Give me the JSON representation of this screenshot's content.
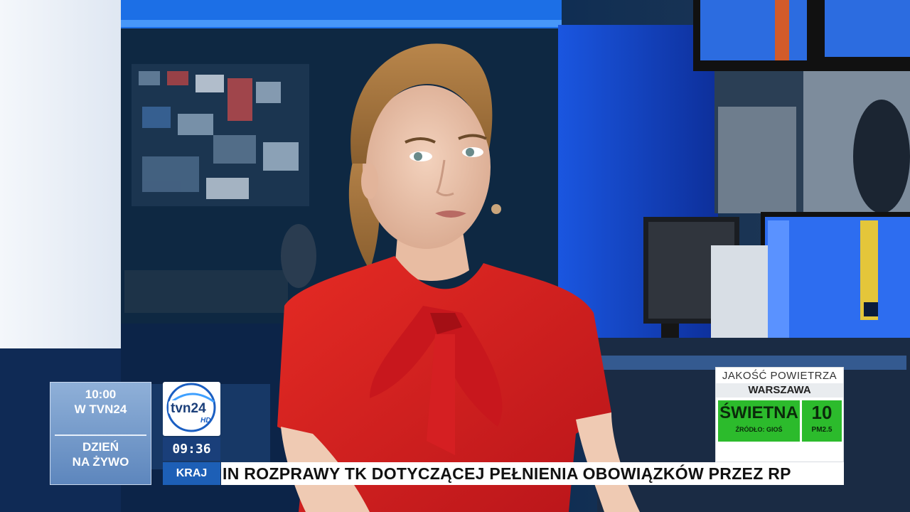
{
  "promo": {
    "top_line1": "10:00",
    "top_line2": "W TVN24",
    "bottom_line1": "DZIEŃ",
    "bottom_line2": "NA ŻYWO"
  },
  "channel": {
    "logo_text": "tvn24",
    "logo_hd": "HD",
    "clock": "09:36",
    "section": "KRAJ"
  },
  "ticker": {
    "text": "IN ROZPRAWY TK DOTYCZĄCEJ PEŁNIENIA OBOWIĄZKÓW PRZEZ RP"
  },
  "air_quality": {
    "title": "JAKOŚĆ POWIETRZA",
    "city": "WARSZAWA",
    "status": "ŚWIETNA",
    "source": "ŹRÓDŁO: GIOŚ",
    "value": "10",
    "unit": "PM2.5",
    "status_color": "#2cbb2c"
  },
  "colors": {
    "red_blouse": "#d61f1f",
    "studio_blue": "#1e5fe0",
    "tvn_blue": "#1d5fb6"
  }
}
